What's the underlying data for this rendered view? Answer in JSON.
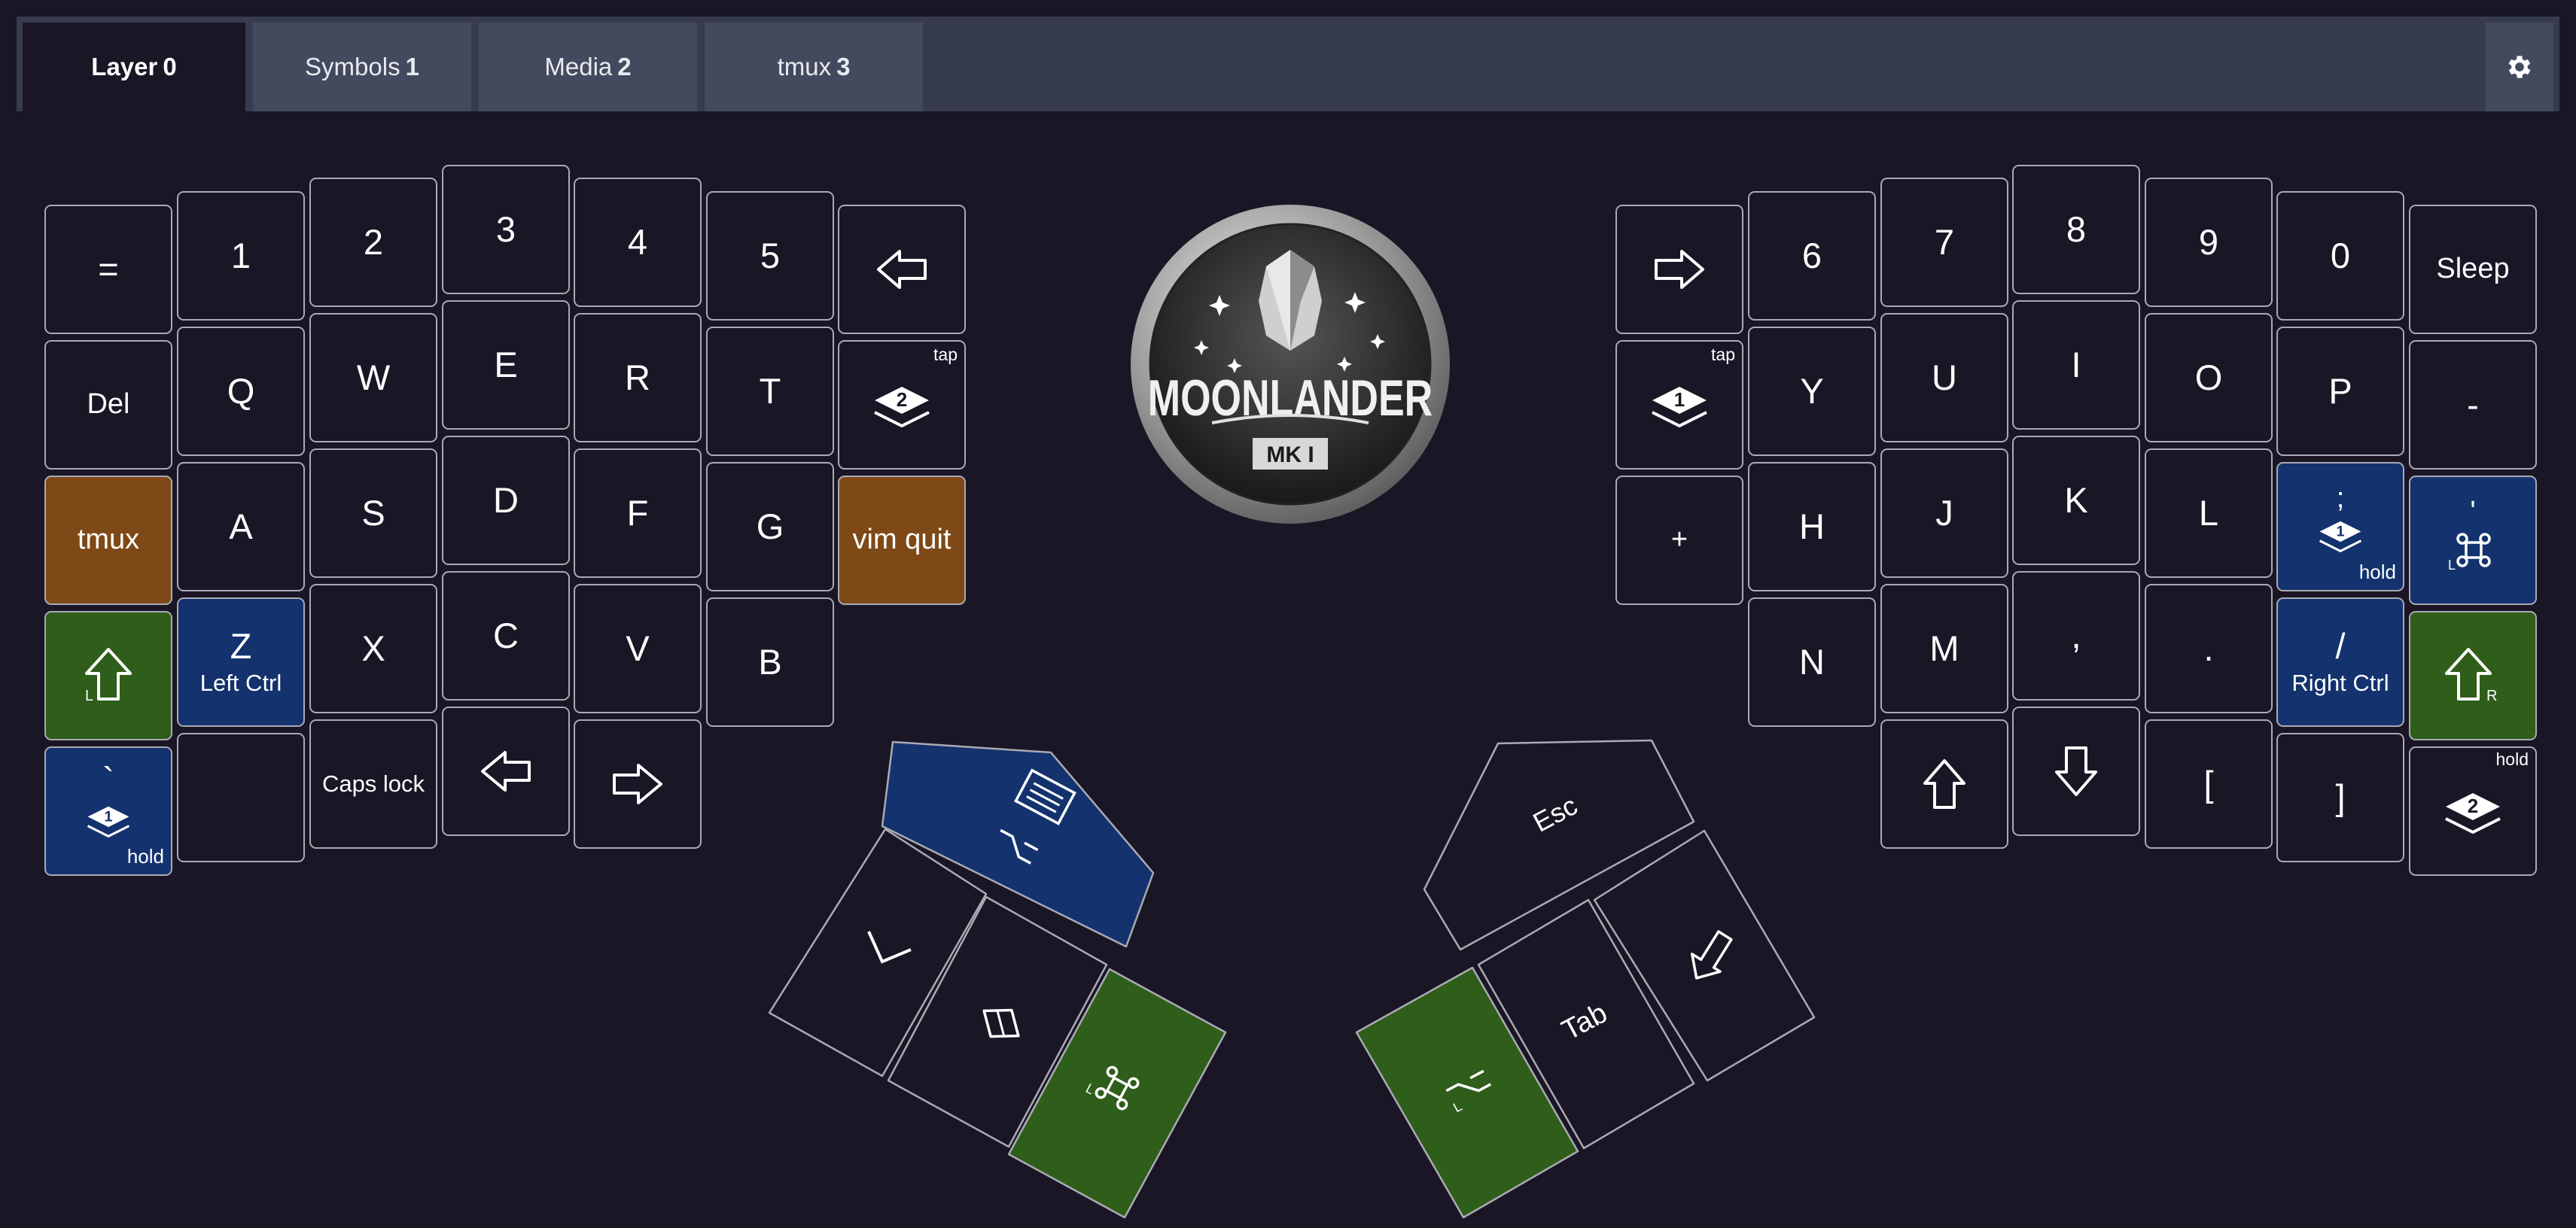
{
  "tabs": [
    {
      "label": "Layer",
      "num": "0"
    },
    {
      "label": "Symbols",
      "num": "1"
    },
    {
      "label": "Media",
      "num": "2"
    },
    {
      "label": "tmux",
      "num": "3"
    }
  ],
  "settings_icon": "gear-icon",
  "logo": {
    "word": "MOONLANDER",
    "mark": "MK I"
  },
  "left": {
    "row0": [
      "=",
      "1",
      "2",
      "3",
      "4",
      "5"
    ],
    "row1": [
      "Del",
      "Q",
      "W",
      "E",
      "R",
      "T"
    ],
    "row2": [
      "tmux",
      "A",
      "S",
      "D",
      "F",
      "G",
      "vim quit"
    ],
    "row3": [
      "X",
      "C",
      "V",
      "B"
    ],
    "z_label": "Z",
    "z_sub": "Left Ctrl",
    "capslock": "Caps lock",
    "backtick": "`",
    "layer2_num": "2",
    "layer1_num": "1",
    "shift_side": "L",
    "cmd_side": "L",
    "alt_side": "L"
  },
  "right": {
    "row0": [
      "6",
      "7",
      "8",
      "9",
      "0",
      "Sleep"
    ],
    "row1": [
      "Y",
      "U",
      "I",
      "O",
      "P",
      "-"
    ],
    "row2": [
      "+",
      "H",
      "J",
      "K",
      "L"
    ],
    "row3": [
      "N",
      "M",
      ",",
      ".",
      "/"
    ],
    "row3_sub": "Right Ctrl",
    "row4": [
      "[",
      "]"
    ],
    "semicolon": ";",
    "quote": "'",
    "layer1_num": "1",
    "layer2_num": "2",
    "shift_side": "R",
    "cmd_side": "L",
    "alt_side": "L"
  },
  "badges": {
    "tap": "tap",
    "hold": "hold"
  },
  "thumbs": {
    "esc": "Esc",
    "tab": "Tab"
  },
  "colors": {
    "orange": "#7e4917",
    "blue": "#13326e",
    "green": "#2f5d1a",
    "background": "#1a1625",
    "tab_bg": "#444a5e"
  }
}
